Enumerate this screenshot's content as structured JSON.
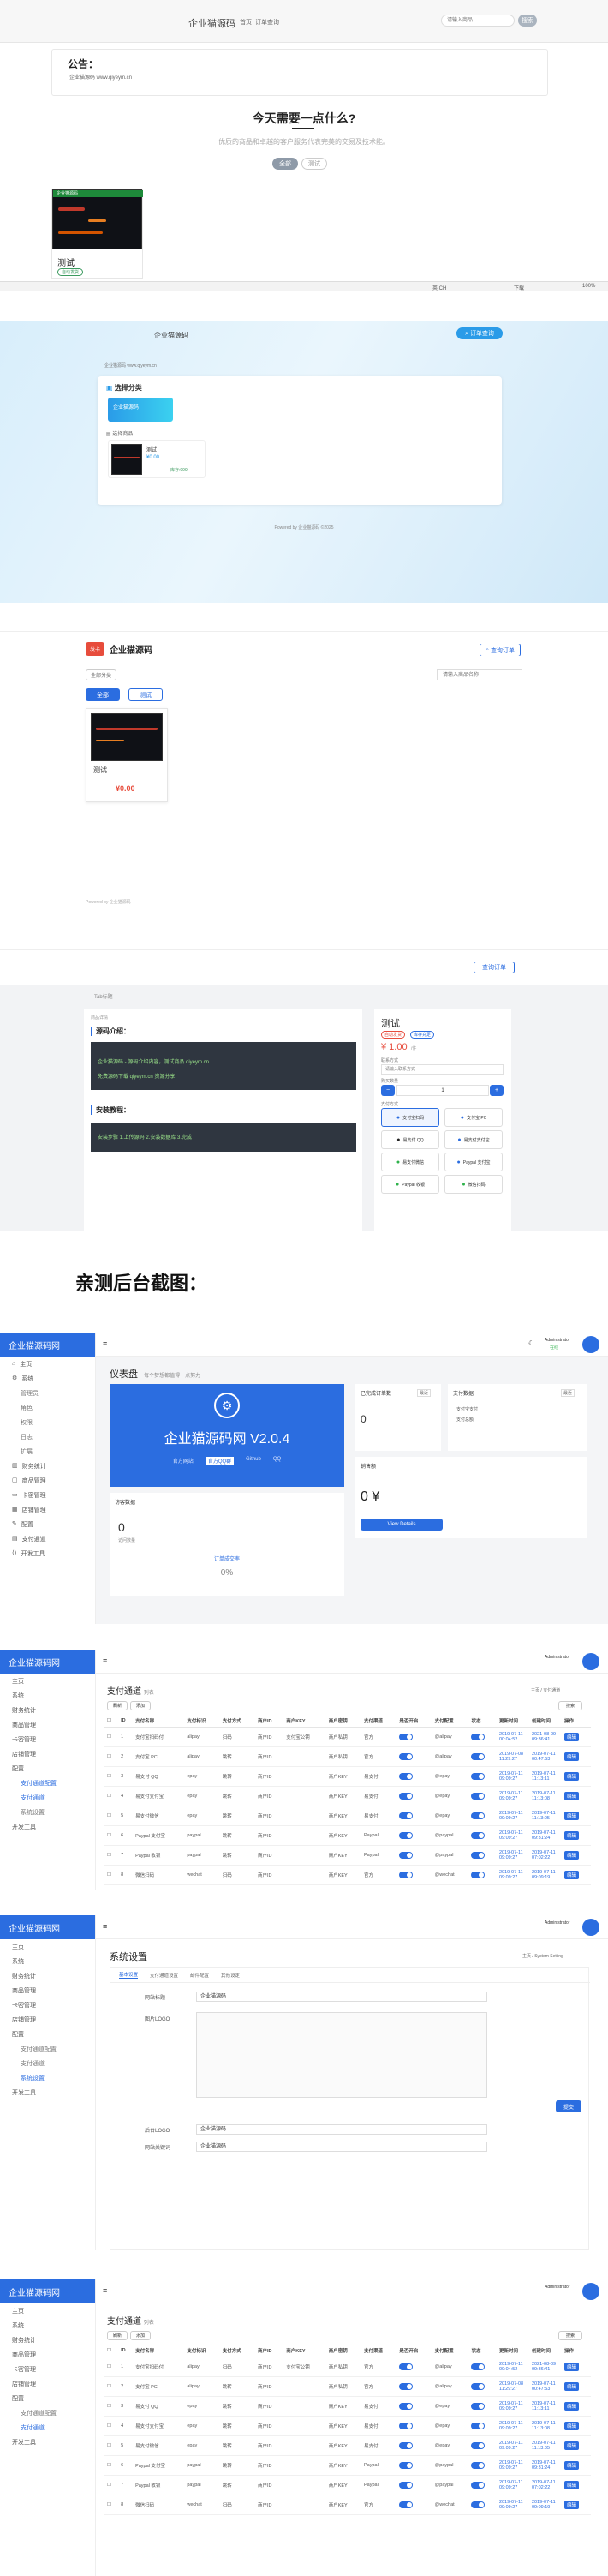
{
  "s1": {
    "brand": "企业猫源码",
    "nav": [
      "首页",
      "订单查询"
    ],
    "search_placeholder": "请输入商品...",
    "search_button": "搜索",
    "notice_title": "公告：",
    "notice_body": "企业猫源码 www.qiyeym.cn",
    "hero_title": "今天需要一点什么?",
    "hero_sub": "优质的商品和卓越的客户服务代表完美的交易及技术能。",
    "btn_primary": "全部",
    "btn_secondary": "测试",
    "product_name": "测试",
    "product_tag": "自动发货",
    "thumb_caption": "企业猫源码",
    "status": [
      "英 CH",
      "下载",
      "100%"
    ]
  },
  "s2": {
    "brand": "企业猫源码",
    "badge": "订单查询",
    "notice": "企业猫源码 www.qiyeym.cn",
    "cat_title": "选择分类",
    "cat_btn": "企业猫源码",
    "goods_title": "选择商品",
    "item_name": "测试",
    "item_price": "¥0.00",
    "item_stock": "库存:999",
    "footer": "Powered by 企业猫源码 ©2025"
  },
  "s3": {
    "logo_text": "企业猫源码",
    "logo_mark": "发卡",
    "order_btn": "查询订单",
    "filter": "全部分类",
    "search_placeholder": "请输入商品名称",
    "tabs": [
      "全部",
      "测试"
    ],
    "product_name": "测试",
    "product_price": "¥0.00",
    "footer": "Powered by 企业猫源码"
  },
  "s4": {
    "order_btn": "查询订单",
    "breadcrumb": "Tab标题",
    "crumb": "商品详情",
    "intro_title": "源码介绍：",
    "intro_code_1": "企业猫源码 - 源码介绍内容，测试商品 qiyeym.cn",
    "intro_code_2": "免费源码下载 qiyeym.cn 资源分享",
    "tutorial_title": "安装教程：",
    "tutorial_code": "安装步骤 1.上传源码 2.安装数据库 3.完成",
    "title": "测试",
    "badges": [
      "自动发货",
      "库存充足"
    ],
    "price": "¥ 1.00",
    "price_unit": "/件",
    "contact_label": "联系方式",
    "contact_placeholder": "请输入联系方式",
    "qty_label": "购买数量",
    "qty_value": "1",
    "pay_label": "支付方式",
    "pay": [
      "支付宝扫码",
      "支付宝 PC",
      "易支付 QQ",
      "易支付支付宝",
      "易支付微信",
      "Paypal 支付宝",
      "Paypal 收银",
      "微信扫码"
    ]
  },
  "caption": "亲测后台截图：",
  "admin": {
    "brand": "企业猫源码网",
    "user": "Administrator",
    "online": "在线",
    "menu": [
      "主页",
      "系统",
      "财务统计",
      "商品管理",
      "卡密管理",
      "店铺管理",
      "配置",
      "支付通道",
      "开发工具"
    ],
    "menu_sub1": [
      "管理员",
      "角色",
      "权限",
      "日志",
      "扩展"
    ],
    "menu_sub2": [
      "支付通道配置",
      "支付通道",
      "系统设置"
    ],
    "dash_title": "仪表盘",
    "dash_sub": "每个梦想都值得一点努力",
    "dash_ver": "企业猫源码网 V2.0.4",
    "dash_links": [
      "官方网站",
      "官方QQ群",
      "Github",
      "QQ"
    ],
    "card_orders": "已完成订单数",
    "card_orders_val": "0",
    "card_pay": "支付数据",
    "card_pay_legend": [
      "支付宝支付",
      "支付总额"
    ],
    "card_visit": "访客数据",
    "card_visit_val": "0",
    "card_visit_sub": "访问数量",
    "card_ratio": "订单成交率",
    "card_ratio_val": "0%",
    "card_amount": "销售额",
    "card_amount_val": "0 ¥",
    "card_btn": "View Details",
    "select": "最近",
    "pay_title": "支付通道",
    "pay_title_sub": "列表",
    "crumbs": [
      "主页",
      "支付通道"
    ],
    "toolbar": [
      "刷新",
      "添加"
    ],
    "toolbar_right": "搜索",
    "cols": [
      "ID",
      "支付名称",
      "支付标识",
      "支付方式",
      "商户ID",
      "商户KEY",
      "商户密钥",
      "支付渠道",
      "是否开启",
      "支付配置",
      "状态",
      "更新时间",
      "创建时间",
      "操作"
    ],
    "rows": [
      {
        "id": "1",
        "name": "支付宝扫码付",
        "code": "alipay",
        "type": "扫码",
        "mid": "商户ID",
        "key": "支付宝公钥",
        "secret": "商户私钥",
        "chan": "官方",
        "cfg": "@alipay",
        "upd": "2019-07-11 00:04:52",
        "crt": "2021-08-09 09:36:41"
      },
      {
        "id": "2",
        "name": "支付宝 PC",
        "code": "alipay",
        "type": "跳转",
        "mid": "商户ID",
        "key": "",
        "secret": "商户私钥",
        "chan": "官方",
        "cfg": "@alipay",
        "upd": "2019-07-08 11:29:27",
        "crt": "2019-07-11 00:47:53"
      },
      {
        "id": "3",
        "name": "易支付 QQ",
        "code": "epay",
        "type": "跳转",
        "mid": "商户ID",
        "key": "",
        "secret": "商户KEY",
        "chan": "易支付",
        "cfg": "@epay",
        "upd": "2019-07-11 09:09:27",
        "crt": "2019-07-11 11:13:11"
      },
      {
        "id": "4",
        "name": "易支付支付宝",
        "code": "epay",
        "type": "跳转",
        "mid": "商户ID",
        "key": "",
        "secret": "商户KEY",
        "chan": "易支付",
        "cfg": "@epay",
        "upd": "2019-07-11 09:09:27",
        "crt": "2019-07-11 11:13:08"
      },
      {
        "id": "5",
        "name": "易支付微信",
        "code": "epay",
        "type": "跳转",
        "mid": "商户ID",
        "key": "",
        "secret": "商户KEY",
        "chan": "易支付",
        "cfg": "@epay",
        "upd": "2019-07-11 09:09:27",
        "crt": "2019-07-11 11:13:05"
      },
      {
        "id": "6",
        "name": "Paypal 支付宝",
        "code": "paypal",
        "type": "跳转",
        "mid": "商户ID",
        "key": "",
        "secret": "商户KEY",
        "chan": "Paypal",
        "cfg": "@paypal",
        "upd": "2019-07-11 09:09:27",
        "crt": "2019-07-11 09:31:24"
      },
      {
        "id": "7",
        "name": "Paypal 收银",
        "code": "paypal",
        "type": "跳转",
        "mid": "商户ID",
        "key": "",
        "secret": "商户KEY",
        "chan": "Paypal",
        "cfg": "@paypal",
        "upd": "2019-07-11 09:09:27",
        "crt": "2019-07-11 07:02:22"
      },
      {
        "id": "8",
        "name": "微信扫码",
        "code": "wechat",
        "type": "扫码",
        "mid": "商户ID",
        "key": "",
        "secret": "商户KEY",
        "chan": "官方",
        "cfg": "@wechat",
        "upd": "2019-07-11 09:09:27",
        "crt": "2019-07-11 09:09:19"
      }
    ],
    "row_edit": "编辑",
    "sys_title": "系统设置",
    "sys_crumbs": [
      "主页",
      "System Setting"
    ],
    "sys_tabs": [
      "基本设置",
      "支付通道设置",
      "邮件配置",
      "其他设定"
    ],
    "sys_label_title": "网站标题",
    "sys_val_title": "企业猫源码",
    "sys_label_logo": "图片LOGO",
    "sys_save": "提交",
    "sys_label_icon": "后台LOGO",
    "sys_val_icon": "企业猫源码",
    "sys_label_desc": "网站关键词",
    "sys_val_desc": "企业猫源码"
  },
  "colors": {
    "blue": "#2b6de0",
    "accent": "#2a9be8",
    "red": "#e74c3c",
    "dark": "#2f3640"
  }
}
